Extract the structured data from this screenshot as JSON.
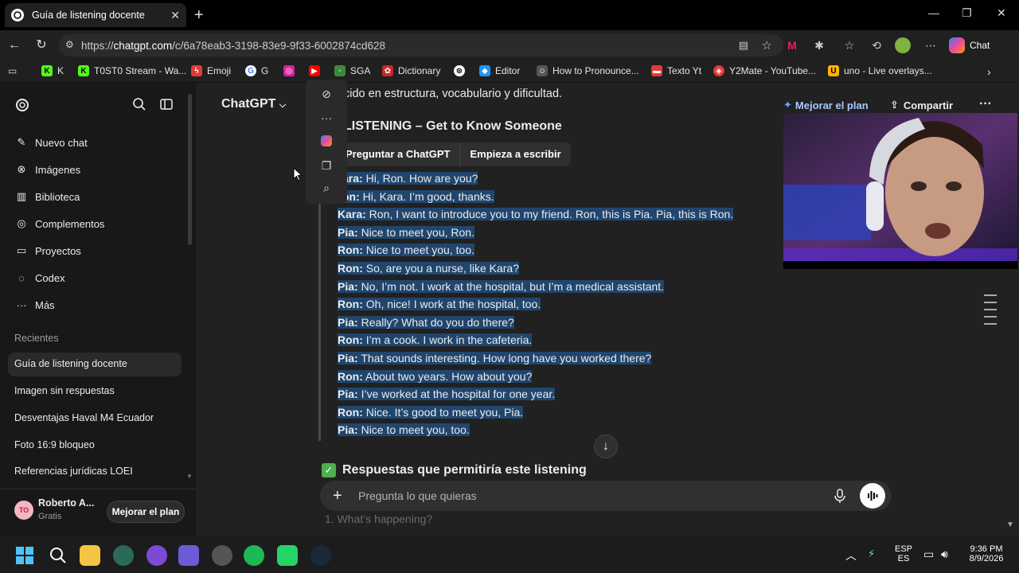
{
  "browser": {
    "tab_title": "Guía de listening docente",
    "url_prefix": "https://",
    "url_host": "chatgpt.com",
    "url_path": "/c/6a78eab3-3198-83e9-9f33-6002874cd628",
    "chat_label": "Chat"
  },
  "bookmarks": [
    {
      "label": "K",
      "icon": "kick-icon",
      "color": "#53fc18"
    },
    {
      "label": "T0ST0 Stream - Wa...",
      "icon": "kick-icon",
      "color": "#53fc18"
    },
    {
      "label": "Emoji",
      "icon": "bolt-icon",
      "color": "#e53935"
    },
    {
      "label": "G",
      "icon": "google-icon",
      "color": "#ffffff"
    },
    {
      "label": "",
      "icon": "instagram-icon",
      "color": "#d6249f"
    },
    {
      "label": "",
      "icon": "youtube-icon",
      "color": "#ff0000"
    },
    {
      "label": "SGA",
      "icon": "sga-icon",
      "color": "#3b8a3b"
    },
    {
      "label": "Dictionary",
      "icon": "dictionary-icon",
      "color": "#c62828"
    },
    {
      "label": "",
      "icon": "openai-icon",
      "color": "#ffffff"
    },
    {
      "label": "Editor",
      "icon": "editor-icon",
      "color": "#2196f3"
    },
    {
      "label": "How to Pronounce...",
      "icon": "pronounce-icon",
      "color": "#ffffff"
    },
    {
      "label": "Texto Yt",
      "icon": "texto-icon",
      "color": "#e53935"
    },
    {
      "label": "Y2Mate - YouTube...",
      "icon": "y2mate-icon",
      "color": "#e53935"
    },
    {
      "label": "uno - Live overlays...",
      "icon": "uno-icon",
      "color": "#ffb300"
    }
  ],
  "sidebar": {
    "items": [
      {
        "label": "Nuevo chat",
        "icon": "compose-icon"
      },
      {
        "label": "Imágenes",
        "icon": "images-icon"
      },
      {
        "label": "Biblioteca",
        "icon": "library-icon"
      },
      {
        "label": "Complementos",
        "icon": "plugins-icon"
      },
      {
        "label": "Proyectos",
        "icon": "folder-icon"
      },
      {
        "label": "Codex",
        "icon": "codex-icon"
      },
      {
        "label": "Más",
        "icon": "more-icon"
      }
    ],
    "recents_heading": "Recientes",
    "recents": [
      "Guía de listening docente",
      "Imagen sin respuestas",
      "Desventajas Haval M4 Ecuador",
      "Foto 16:9 bloqueo",
      "Referencias jurídicas LOEI"
    ],
    "user_initials": "TO",
    "user_name": "Roberto A...",
    "user_plan": "Gratis",
    "upgrade_label": "Mejorar el plan"
  },
  "header": {
    "model": "ChatGPT",
    "upgrade": "Mejorar el plan",
    "share": "Compartir"
  },
  "content": {
    "top_line": "cido en estructura, vocabulario y dificultad.",
    "heading": "LISTENING – Get to Know Someone",
    "ask_button": "Preguntar a ChatGPT",
    "write_button": "Empieza a escribir",
    "dialogue": [
      {
        "speaker": "ara:",
        "text": " Hi, Ron. How are you?"
      },
      {
        "speaker": "on:",
        "text": " Hi, Kara. I’m good, thanks."
      },
      {
        "speaker": "Kara:",
        "text": " Ron, I want to introduce you to my friend. Ron, this is Pia. Pia, this is Ron."
      },
      {
        "speaker": "Pia:",
        "text": " Nice to meet you, Ron."
      },
      {
        "speaker": "Ron:",
        "text": " Nice to meet you, too."
      },
      {
        "speaker": "Ron:",
        "text": " So, are you a nurse, like Kara?"
      },
      {
        "speaker": "Pia:",
        "text": " No, I’m not. I work at the hospital, but I’m a medical assistant."
      },
      {
        "speaker": "Ron:",
        "text": " Oh, nice! I work at the hospital, too."
      },
      {
        "speaker": "Pia:",
        "text": " Really? What do you do there?"
      },
      {
        "speaker": "Ron:",
        "text": " I’m a cook. I work in the cafeteria."
      },
      {
        "speaker": "Pia:",
        "text": " That sounds interesting. How long have you worked there?"
      },
      {
        "speaker": "Ron:",
        "text": " About two years. How about you?"
      },
      {
        "speaker": "Pia:",
        "text": " I’ve worked at the hospital for one year."
      },
      {
        "speaker": "Ron:",
        "text": " Nice. It’s good to meet you, Pia."
      },
      {
        "speaker": "Pia:",
        "text": " Nice to meet you, too."
      }
    ],
    "section_heading": "Respuestas que permitiría este listening",
    "underlay_text": "1.  What’s happening?"
  },
  "composer": {
    "placeholder": "Pregunta lo que quieras"
  },
  "taskbar": {
    "lang_top": "ESP",
    "lang_bottom": "ES",
    "time": "9:36 PM",
    "date": "8/9/2026"
  }
}
